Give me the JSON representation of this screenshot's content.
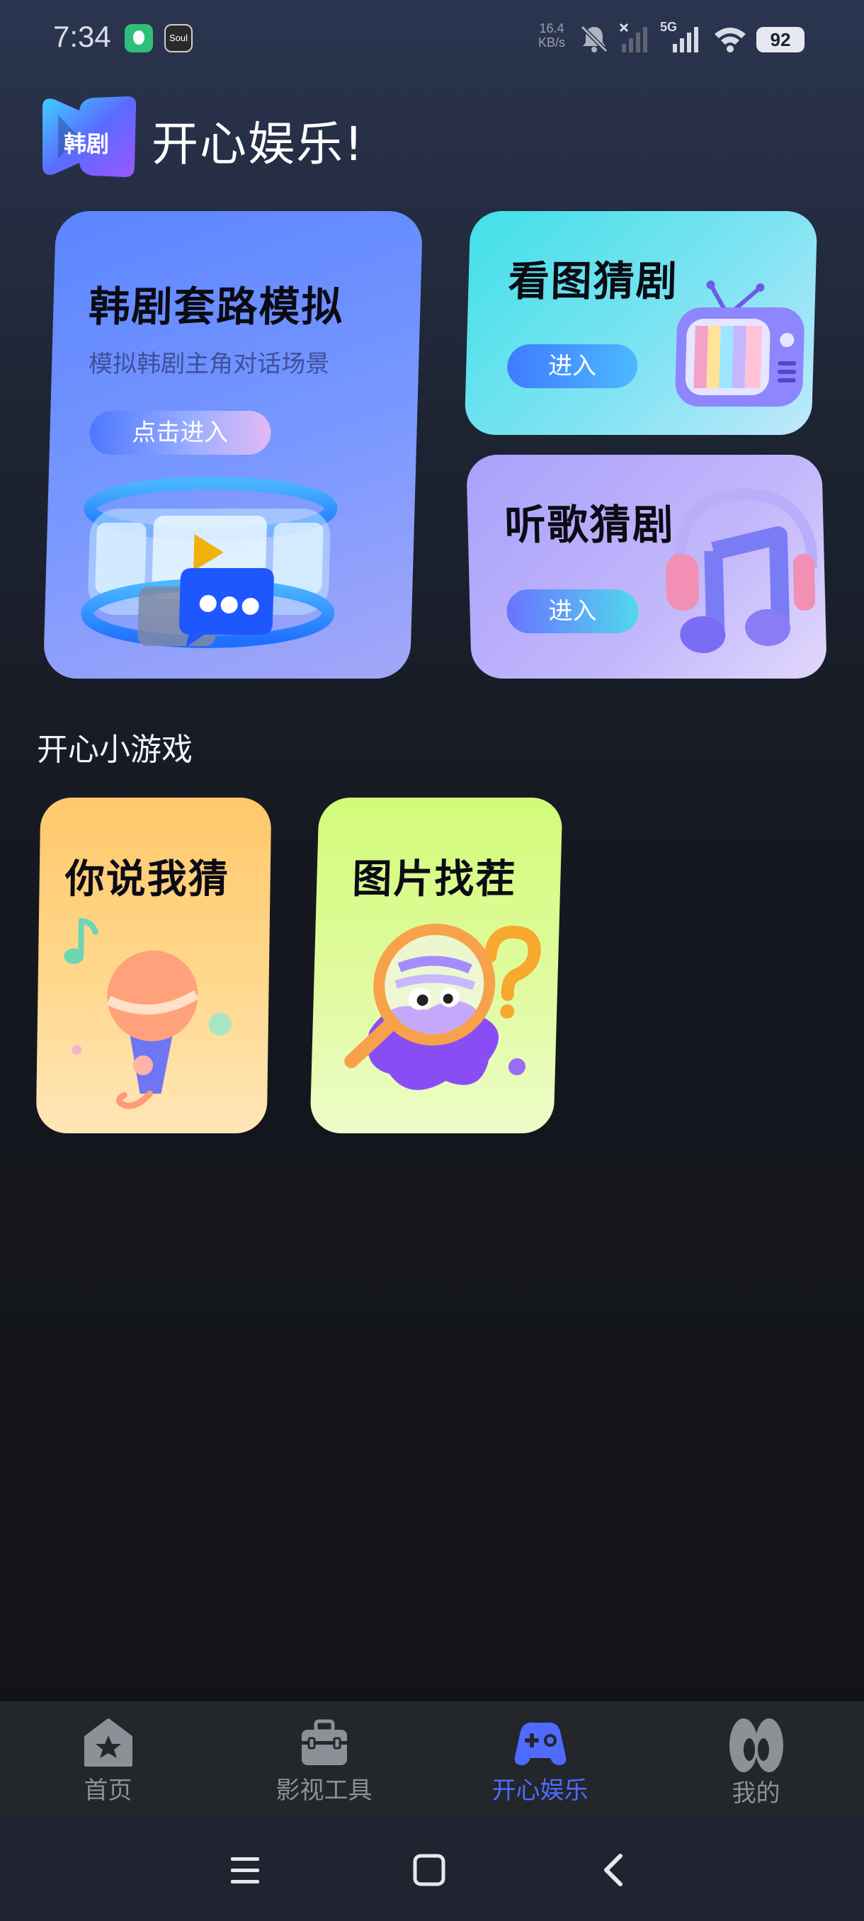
{
  "status_bar": {
    "time": "7:34",
    "app_icon_2_text": "Soul",
    "net_speed_value": "16.4",
    "net_speed_unit": "KB/s",
    "network_type": "5G",
    "battery": "92"
  },
  "header": {
    "logo_text": "韩剧",
    "title": "开心娱乐!"
  },
  "cards": {
    "main": {
      "title": "韩剧套路模拟",
      "subtitle": "模拟韩剧主角对话场景",
      "button": "点击进入"
    },
    "guess_picture": {
      "title": "看图猜剧",
      "button": "进入"
    },
    "guess_song": {
      "title": "听歌猜剧",
      "button": "进入"
    }
  },
  "mini_games": {
    "section_title": "开心小游戏",
    "items": [
      {
        "title": "你说我猜"
      },
      {
        "title": "图片找茬"
      }
    ]
  },
  "bottom_nav": {
    "items": [
      {
        "label": "首页"
      },
      {
        "label": "影视工具"
      },
      {
        "label": "开心娱乐"
      },
      {
        "label": "我的"
      }
    ],
    "active_color": "#4f6bff",
    "inactive_color": "#8d9096"
  }
}
